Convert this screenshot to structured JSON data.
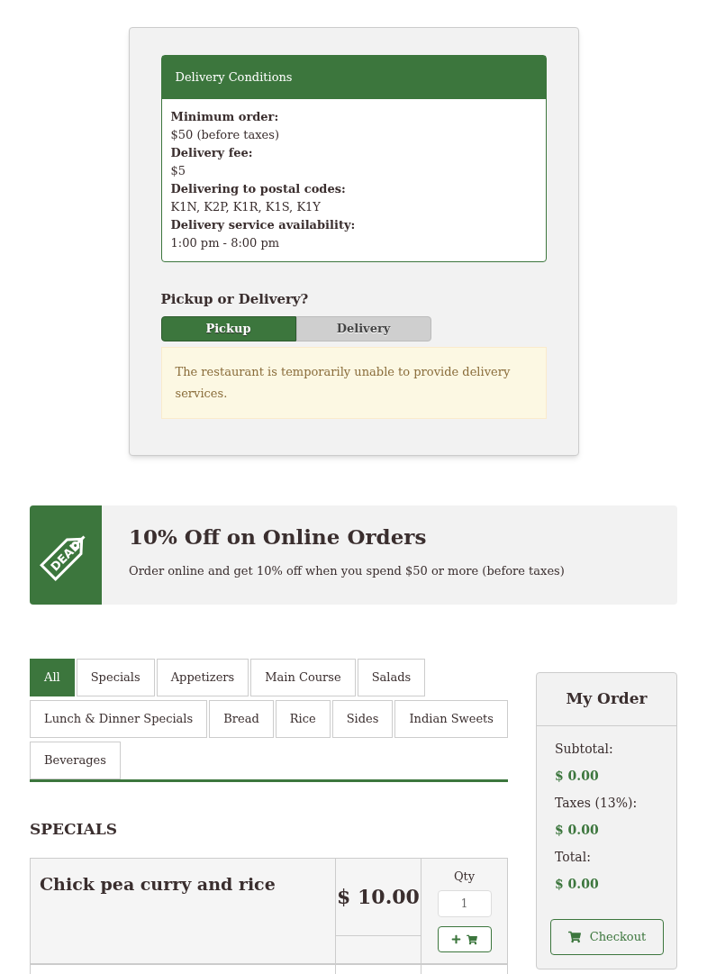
{
  "delivery_conditions": {
    "title": "Delivery Conditions",
    "items": [
      {
        "label": "Minimum order:",
        "value": "$50 (before taxes)"
      },
      {
        "label": "Delivery fee:",
        "value": "$5"
      },
      {
        "label": "Delivering to postal codes:",
        "value": "K1N, K2P, K1R, K1S, K1Y"
      },
      {
        "label": "Delivery service availability:",
        "value": "1:00 pm - 8:00 pm"
      }
    ]
  },
  "order_type": {
    "question": "Pickup or Delivery?",
    "options": [
      {
        "label": "Pickup",
        "selected": true
      },
      {
        "label": "Delivery",
        "selected": false
      }
    ],
    "notice": "The restaurant is temporarily unable to provide delivery services."
  },
  "promo": {
    "badge": "DEAL",
    "title": "10% Off on Online Orders",
    "text": "Order online and get 10% off when you spend $50 or more (before taxes)"
  },
  "category_tabs": [
    {
      "label": "All",
      "selected": true
    },
    {
      "label": "Specials",
      "selected": false
    },
    {
      "label": "Appetizers",
      "selected": false
    },
    {
      "label": "Main Course",
      "selected": false
    },
    {
      "label": "Salads",
      "selected": false
    },
    {
      "label": "Lunch & Dinner Specials",
      "selected": false
    },
    {
      "label": "Bread",
      "selected": false
    },
    {
      "label": "Rice",
      "selected": false
    },
    {
      "label": "Sides",
      "selected": false
    },
    {
      "label": "Indian Sweets",
      "selected": false
    },
    {
      "label": "Beverages",
      "selected": false
    }
  ],
  "section_title": "SPECIALS",
  "menu_items": [
    {
      "name": "Chick pea curry and rice",
      "price": "$ 10.00",
      "qty_label": "Qty",
      "qty": "1"
    }
  ],
  "my_order": {
    "title": "My Order",
    "lines": [
      {
        "label": "Subtotal:",
        "amount": "$ 0.00"
      },
      {
        "label": "Taxes (13%):",
        "amount": "$ 0.00"
      },
      {
        "label": "Total:",
        "amount": "$ 0.00"
      }
    ],
    "checkout": "Checkout"
  }
}
